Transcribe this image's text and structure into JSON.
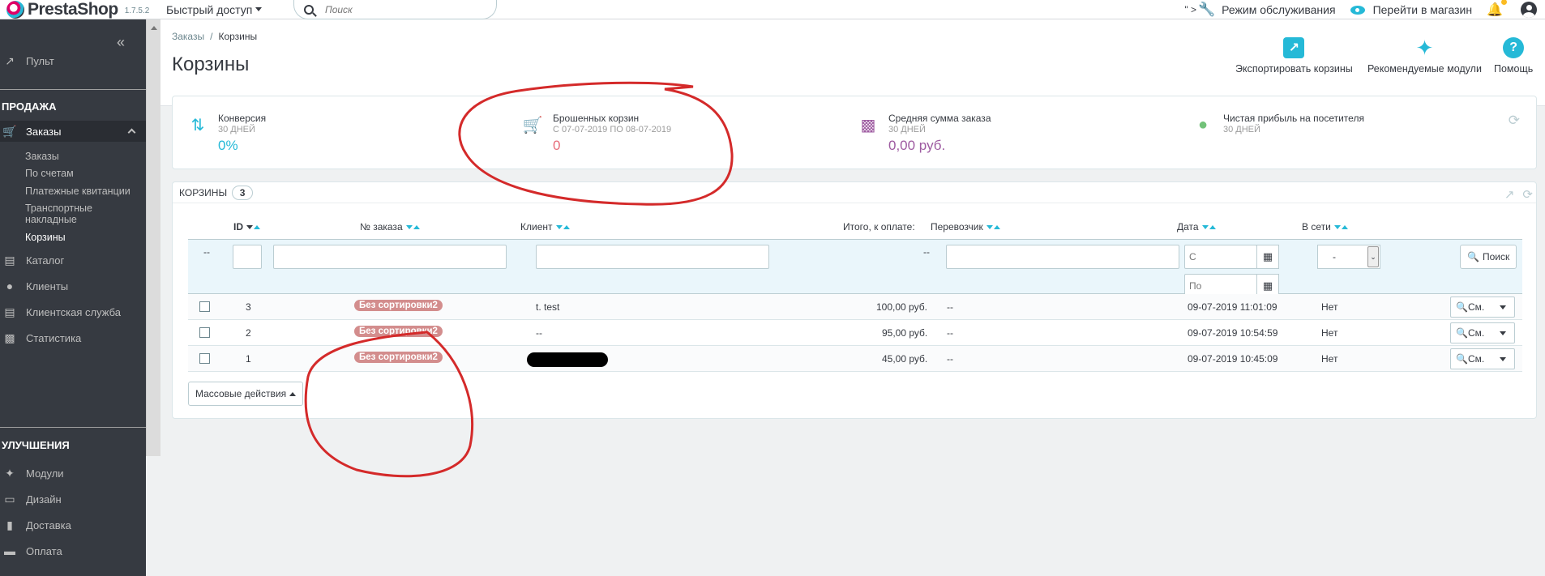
{
  "topbar": {
    "brand": "PrestaShop",
    "version": "1.7.5.2",
    "quick_access": "Быстрый доступ",
    "search_placeholder": "Поиск",
    "debug_marker": "\" >",
    "maintenance": "Режим обслуживания",
    "view_shop": "Перейти в магазин"
  },
  "sidebar": {
    "dashboard": "Пульт",
    "section_sell": "ПРОДАЖА",
    "orders": "Заказы",
    "orders_sub": [
      "Заказы",
      "По счетам",
      "Платежные квитанции",
      "Транспортные накладные",
      "Корзины"
    ],
    "catalog": "Каталог",
    "customers": "Клиенты",
    "customer_service": "Клиентская служба",
    "stats": "Статистика",
    "section_improve": "УЛУЧШЕНИЯ",
    "modules": "Модули",
    "design": "Дизайн",
    "shipping": "Доставка",
    "payment": "Оплата"
  },
  "header": {
    "breadcrumb_parent": "Заказы",
    "breadcrumb_current": "Корзины",
    "title": "Корзины",
    "toolbar": {
      "export": "Экспортировать корзины",
      "modules": "Рекомендуемые модули",
      "help": "Помощь"
    }
  },
  "kpis": [
    {
      "title": "Конверсия",
      "subtitle": "30 ДНЕЙ",
      "value": "0%",
      "color": "#25b9d7"
    },
    {
      "title": "Брошенных корзин",
      "subtitle": "С 07-07-2019 ПО 08-07-2019",
      "value": "0",
      "color": "#e76d7a"
    },
    {
      "title": "Средняя сумма заказа",
      "subtitle": "30 ДНЕЙ",
      "value": "0,00 руб.",
      "color": "#9e5ba1"
    },
    {
      "title": "Чистая прибыль на посетителя",
      "subtitle": "30 ДНЕЙ",
      "value": "",
      "color": "#72c279"
    }
  ],
  "list": {
    "title": "Корзины",
    "count": "3",
    "columns": {
      "id": "ID",
      "order": "№ заказа",
      "customer": "Клиент",
      "total": "Итого, к оплате:",
      "carrier": "Перевозчик",
      "date": "Дата",
      "online": "В сети"
    },
    "filters": {
      "dash": "--",
      "date_from": "С",
      "date_to": "По",
      "online_select": "-",
      "search_button": "Поиск"
    },
    "rows": [
      {
        "id": "3",
        "order": "Без сортировки2",
        "customer": "t. test",
        "total": "100,00 руб.",
        "carrier": "--",
        "date": "09-07-2019 11:01:09",
        "online": "Нет",
        "action": "См."
      },
      {
        "id": "2",
        "order": "Без сортировки2",
        "customer": "--",
        "total": "95,00 руб.",
        "carrier": "--",
        "date": "09-07-2019 10:54:59",
        "online": "Нет",
        "action": "См."
      },
      {
        "id": "1",
        "order": "Без сортировки2",
        "customer": "",
        "total": "45,00 руб.",
        "carrier": "--",
        "date": "09-07-2019 10:45:09",
        "online": "Нет",
        "action": "См."
      }
    ],
    "bulk_actions": "Массовые действия"
  }
}
